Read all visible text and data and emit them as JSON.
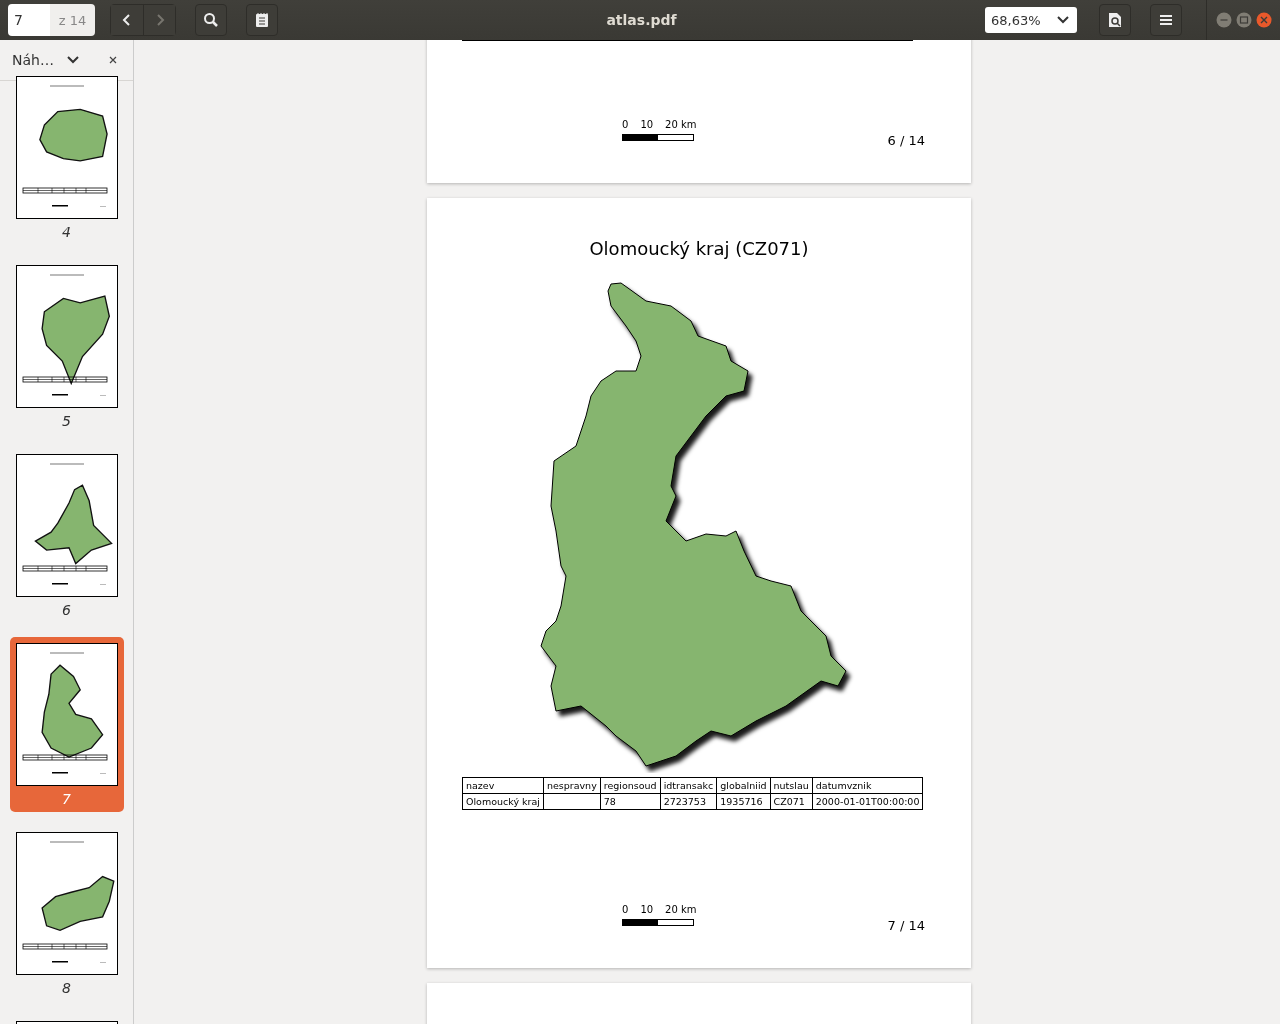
{
  "toolbar": {
    "page_field": {
      "value": "7"
    },
    "page_count": "z 14",
    "nav_buttons": [
      {
        "kind": "back",
        "disabled": false
      },
      {
        "kind": "forward",
        "disabled": true
      }
    ],
    "title": "atlas.pdf",
    "zoom": {
      "value": "68,63%"
    }
  },
  "sidebar": {
    "header": {
      "title": "Náh…"
    },
    "thumbnails": [
      {
        "label": "4",
        "selected": false
      },
      {
        "label": "5",
        "selected": false
      },
      {
        "label": "6",
        "selected": false
      },
      {
        "label": "7",
        "selected": true
      },
      {
        "label": "8",
        "selected": false
      },
      {
        "selected": false
      }
    ]
  },
  "document": {
    "pages": [
      {
        "scale_labels": [
          "0",
          "10",
          "20 km"
        ],
        "page_label": "6 / 14"
      },
      {
        "title": "Olomoucký kraj (CZ071)",
        "table": {
          "columns": [
            "nazev",
            "nespravny",
            "regionsoud",
            "idtransakc",
            "globalniid",
            "nutslau",
            "datumvznik"
          ],
          "rows": [
            [
              "Olomoucký kraj",
              null,
              "78",
              "2723753",
              "1935716",
              "CZ071",
              "2000-01-01T00:00:00"
            ]
          ]
        },
        "scale_labels": [
          "0",
          "10",
          "20 km"
        ],
        "page_label": "7 / 14"
      }
    ]
  }
}
